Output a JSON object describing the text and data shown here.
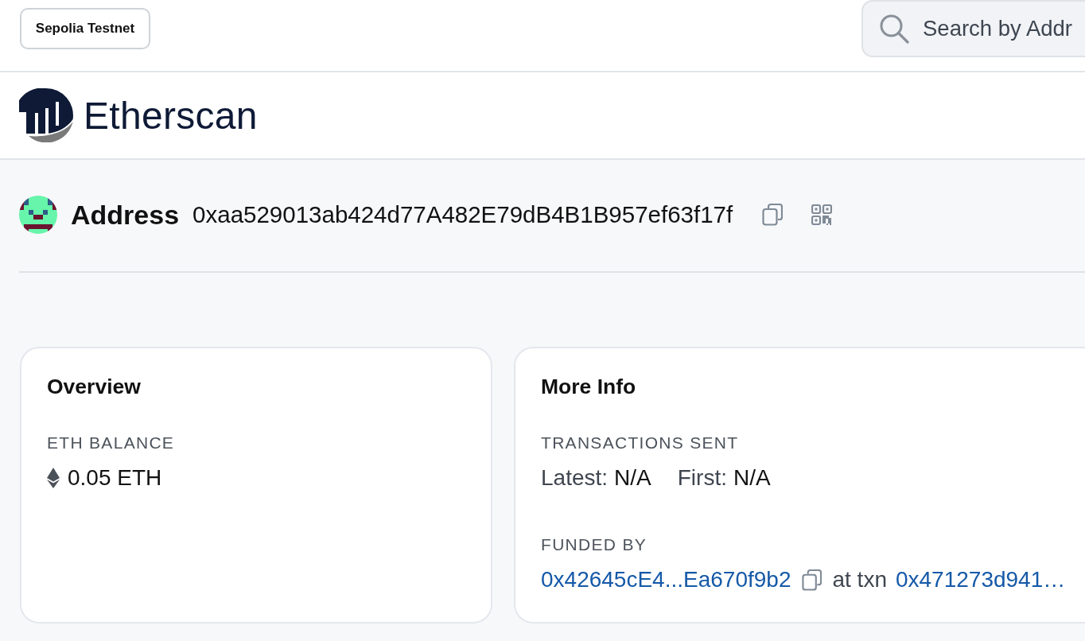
{
  "top_bar": {
    "network_button": "Sepolia Testnet",
    "search": {
      "placeholder": "Search by Addr"
    }
  },
  "header": {
    "logo_text": "Etherscan"
  },
  "address": {
    "title": "Address",
    "hash": "0xaa529013ab424d77A482E79dB4B1B957ef63f17f"
  },
  "cards": [
    {
      "title": "Overview",
      "sections": [
        {
          "kind": "balance",
          "label": "ETH BALANCE",
          "value": "0.05 ETH"
        }
      ]
    },
    {
      "title": "More Info",
      "sections": [
        {
          "kind": "pairs",
          "label": "TRANSACTIONS SENT",
          "pairs": [
            {
              "label": "Latest:",
              "value": "N/A"
            },
            {
              "label": "First:",
              "value": "N/A"
            }
          ]
        },
        {
          "kind": "funding",
          "label": "FUNDED BY",
          "from": "0x42645cE4...Ea670f9b2",
          "connector": "at txn",
          "txn": "0x471273d941…"
        }
      ]
    }
  ]
}
